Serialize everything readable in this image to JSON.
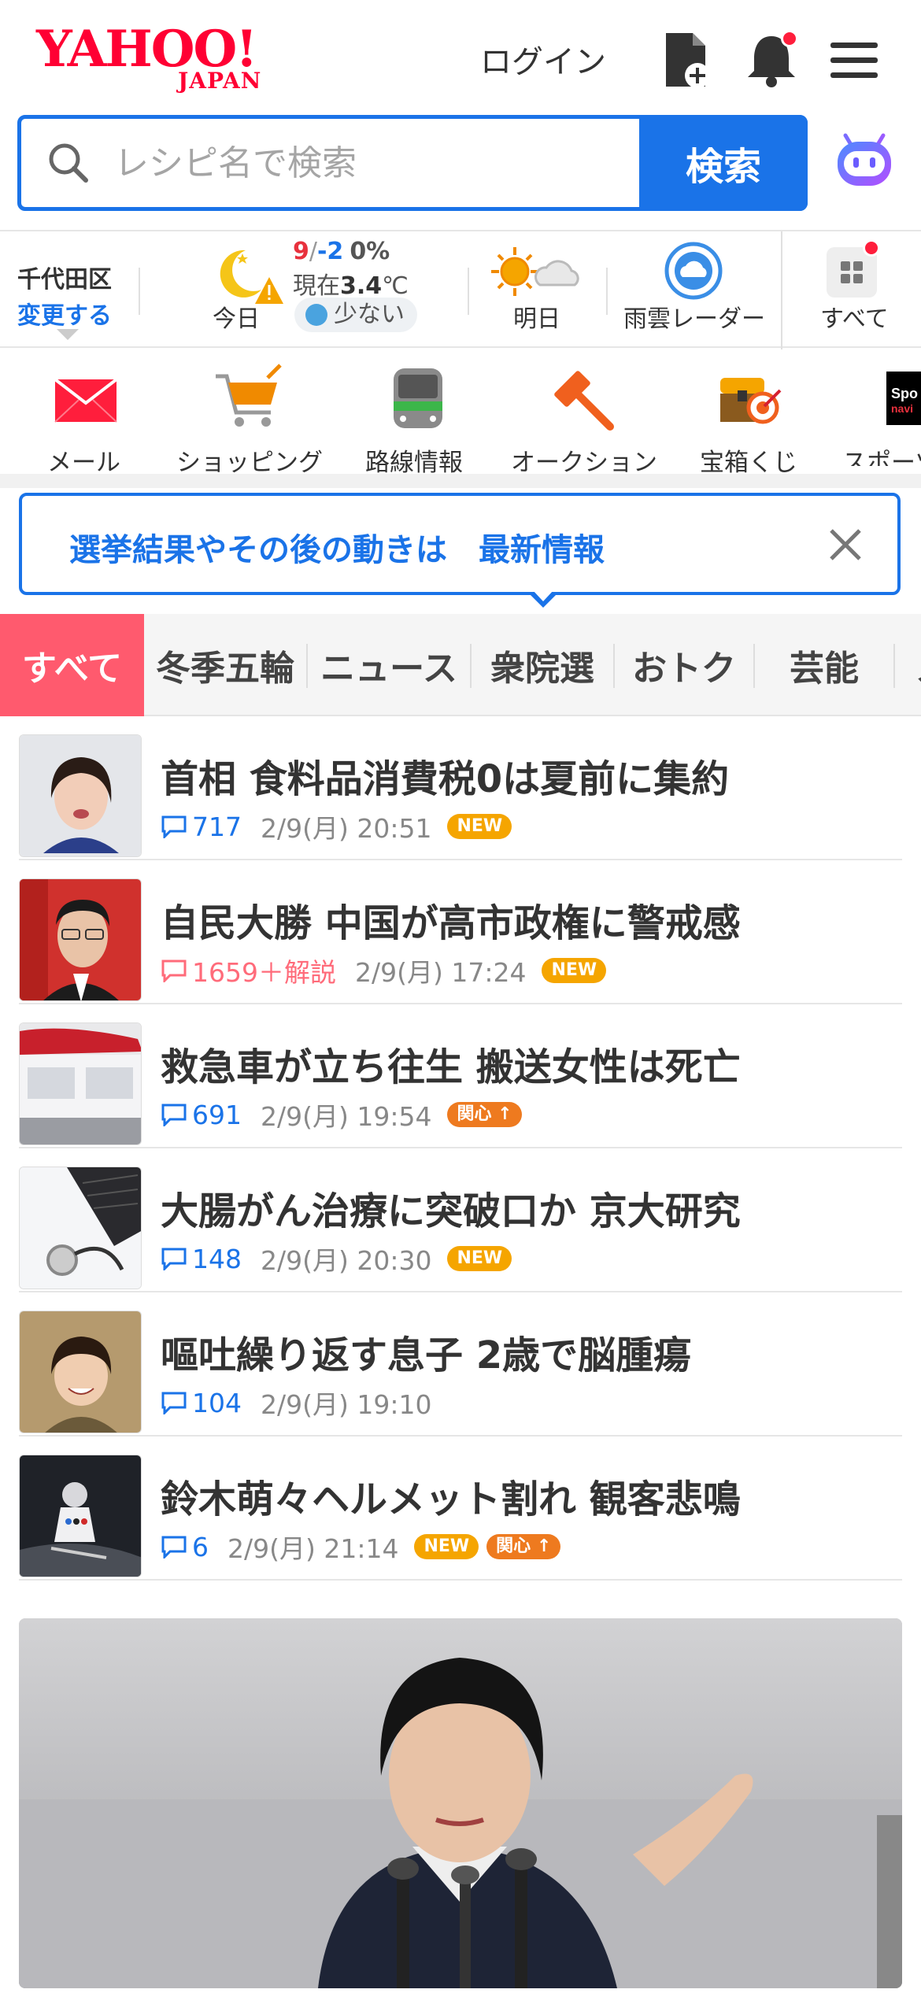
{
  "header": {
    "logo_main": "YAHOO!",
    "logo_sub": "JAPAN",
    "login_label": "ログイン"
  },
  "search": {
    "placeholder": "レシピ名で検索",
    "button_label": "検索"
  },
  "weather": {
    "location": "千代田区",
    "change_label": "変更する",
    "today_label": "今日",
    "high": "9",
    "separator": "/",
    "low": "-2",
    "precip": "0%",
    "now_prefix": "現在",
    "now_value": "3.4",
    "now_unit": "℃",
    "pollen": "少ない",
    "tomorrow_label": "明日",
    "radar_label": "雨雲レーダー",
    "all_label": "すべて"
  },
  "services": [
    {
      "label": "メール",
      "icon": "mail-icon"
    },
    {
      "label": "ショッピング",
      "icon": "shopping-cart-icon"
    },
    {
      "label": "路線情報",
      "icon": "train-icon"
    },
    {
      "label": "オークション",
      "icon": "auction-hammer-icon"
    },
    {
      "label": "宝箱くじ",
      "icon": "treasure-box-icon"
    },
    {
      "label": "スポーツ",
      "icon": "sports-icon"
    }
  ],
  "banner": {
    "text": "選挙結果やその後の動きは",
    "link": "最新情報"
  },
  "tabs": [
    "すべて",
    "冬季五輪",
    "ニュース",
    "衆院選",
    "おトク",
    "芸能",
    "ス"
  ],
  "news": [
    {
      "title": "首相 食料品消費税0は夏前に集約",
      "comments": "717",
      "date": "2/9(月) 20:51",
      "badges": [
        "NEW"
      ]
    },
    {
      "title": "自民大勝 中国が高市政権に警戒感",
      "comments": "1659＋解説",
      "date": "2/9(月) 17:24",
      "badges": [
        "NEW"
      ],
      "hot": true
    },
    {
      "title": "救急車が立ち往生 搬送女性は死亡",
      "comments": "691",
      "date": "2/9(月) 19:54",
      "badges": [
        "関心"
      ]
    },
    {
      "title": "大腸がん治療に突破口か 京大研究",
      "comments": "148",
      "date": "2/9(月) 20:30",
      "badges": [
        "NEW"
      ]
    },
    {
      "title": "嘔吐繰り返す息子 2歳で脳腫瘍",
      "comments": "104",
      "date": "2/9(月) 19:10",
      "badges": []
    },
    {
      "title": "鈴木萌々ヘルメット割れ 観客悲鳴",
      "comments": "6",
      "date": "2/9(月) 21:14",
      "badges": [
        "NEW",
        "関心"
      ]
    }
  ],
  "colors": {
    "brand_red": "#ff0033",
    "accent_blue": "#1a73e8",
    "tab_active": "#ff5a6e",
    "badge_new": "#f5a500",
    "badge_kanshin": "#ee7a1f"
  }
}
